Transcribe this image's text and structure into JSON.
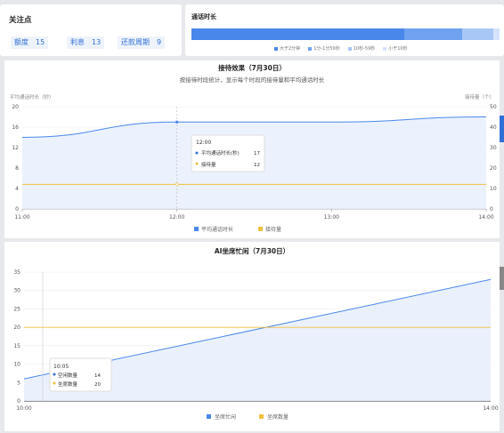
{
  "focus": {
    "title": "关注点",
    "tags": [
      {
        "label": "额度",
        "value": "15"
      },
      {
        "label": "利息",
        "value": "13"
      },
      {
        "label": "还款周期",
        "value": "9"
      }
    ]
  },
  "duration": {
    "title": "通话时长",
    "segments": [
      {
        "label": "大于2分钟",
        "fraction": 0.69,
        "color": "#4a87ea"
      },
      {
        "label": "1分-1分59秒",
        "fraction": 0.19,
        "color": "#6fa2f0"
      },
      {
        "label": "10秒-59秒",
        "fraction": 0.1,
        "color": "#a8c7f6"
      },
      {
        "label": "小于10秒",
        "fraction": 0.02,
        "color": "#d6e4fb"
      }
    ]
  },
  "effect_chart": {
    "title": "接待效果（7月30日）",
    "subtitle": "按接待时段统计，显示每个时段的接待量和平均通话时长",
    "left_axis_label": "平均通话时长（秒）",
    "right_axis_label": "接待量（个）",
    "tooltip": {
      "time": "12:00",
      "rows": [
        {
          "name": "平均通话时长(秒)",
          "value": "17",
          "color": "#2f6fd6"
        },
        {
          "name": "接待量",
          "value": "12",
          "color": "#f0c040"
        }
      ]
    },
    "legend": [
      {
        "name": "平均通话时长",
        "color": "#4a87ea"
      },
      {
        "name": "接待量",
        "color": "#f0c040"
      }
    ]
  },
  "ai_chart": {
    "title": "AI坐席忙闲（7月30日）",
    "tooltip": {
      "time": "10:05",
      "rows": [
        {
          "name": "空闲数量",
          "value": "14",
          "color": "#2f6fd6"
        },
        {
          "name": "坐席数量",
          "value": "20",
          "color": "#f0c040"
        }
      ]
    },
    "legend": [
      {
        "name": "坐席忙闲",
        "color": "#4a87ea"
      },
      {
        "name": "坐席数量",
        "color": "#f0c040"
      }
    ]
  },
  "chart_data": [
    {
      "type": "line",
      "title": "接待效果（7月30日）",
      "x": [
        "11:00",
        "12:00",
        "13:00",
        "14:00"
      ],
      "y_left_ticks": [
        0,
        4,
        8,
        12,
        16,
        20
      ],
      "y_right_ticks": [
        0,
        10,
        20,
        30,
        40,
        50
      ],
      "ylim_left": [
        0,
        20
      ],
      "ylim_right": [
        0,
        50
      ],
      "series": [
        {
          "name": "平均通话时长",
          "axis": "left",
          "color": "#4a87ea",
          "area": true,
          "values": [
            14,
            17,
            17,
            18
          ],
          "x_values": [
            0,
            1,
            2,
            3
          ]
        },
        {
          "name": "接待量",
          "axis": "right",
          "color": "#f0c040",
          "area": false,
          "values": [
            12,
            12,
            12,
            12
          ],
          "x_values": [
            0,
            1,
            2,
            3
          ]
        }
      ]
    },
    {
      "type": "line",
      "title": "AI坐席忙闲（7月30日）",
      "x": [
        "10:00",
        "14:00"
      ],
      "y_ticks": [
        0,
        5,
        10,
        15,
        20,
        25,
        30,
        35
      ],
      "ylim": [
        0,
        35
      ],
      "series": [
        {
          "name": "坐席忙闲",
          "color": "#4a87ea",
          "area": true,
          "points": [
            [
              "10:00",
              6
            ],
            [
              "14:00",
              33
            ]
          ]
        },
        {
          "name": "坐席数量",
          "color": "#f0c040",
          "area": false,
          "points": [
            [
              "10:00",
              20
            ],
            [
              "14:00",
              20
            ]
          ]
        }
      ]
    }
  ]
}
